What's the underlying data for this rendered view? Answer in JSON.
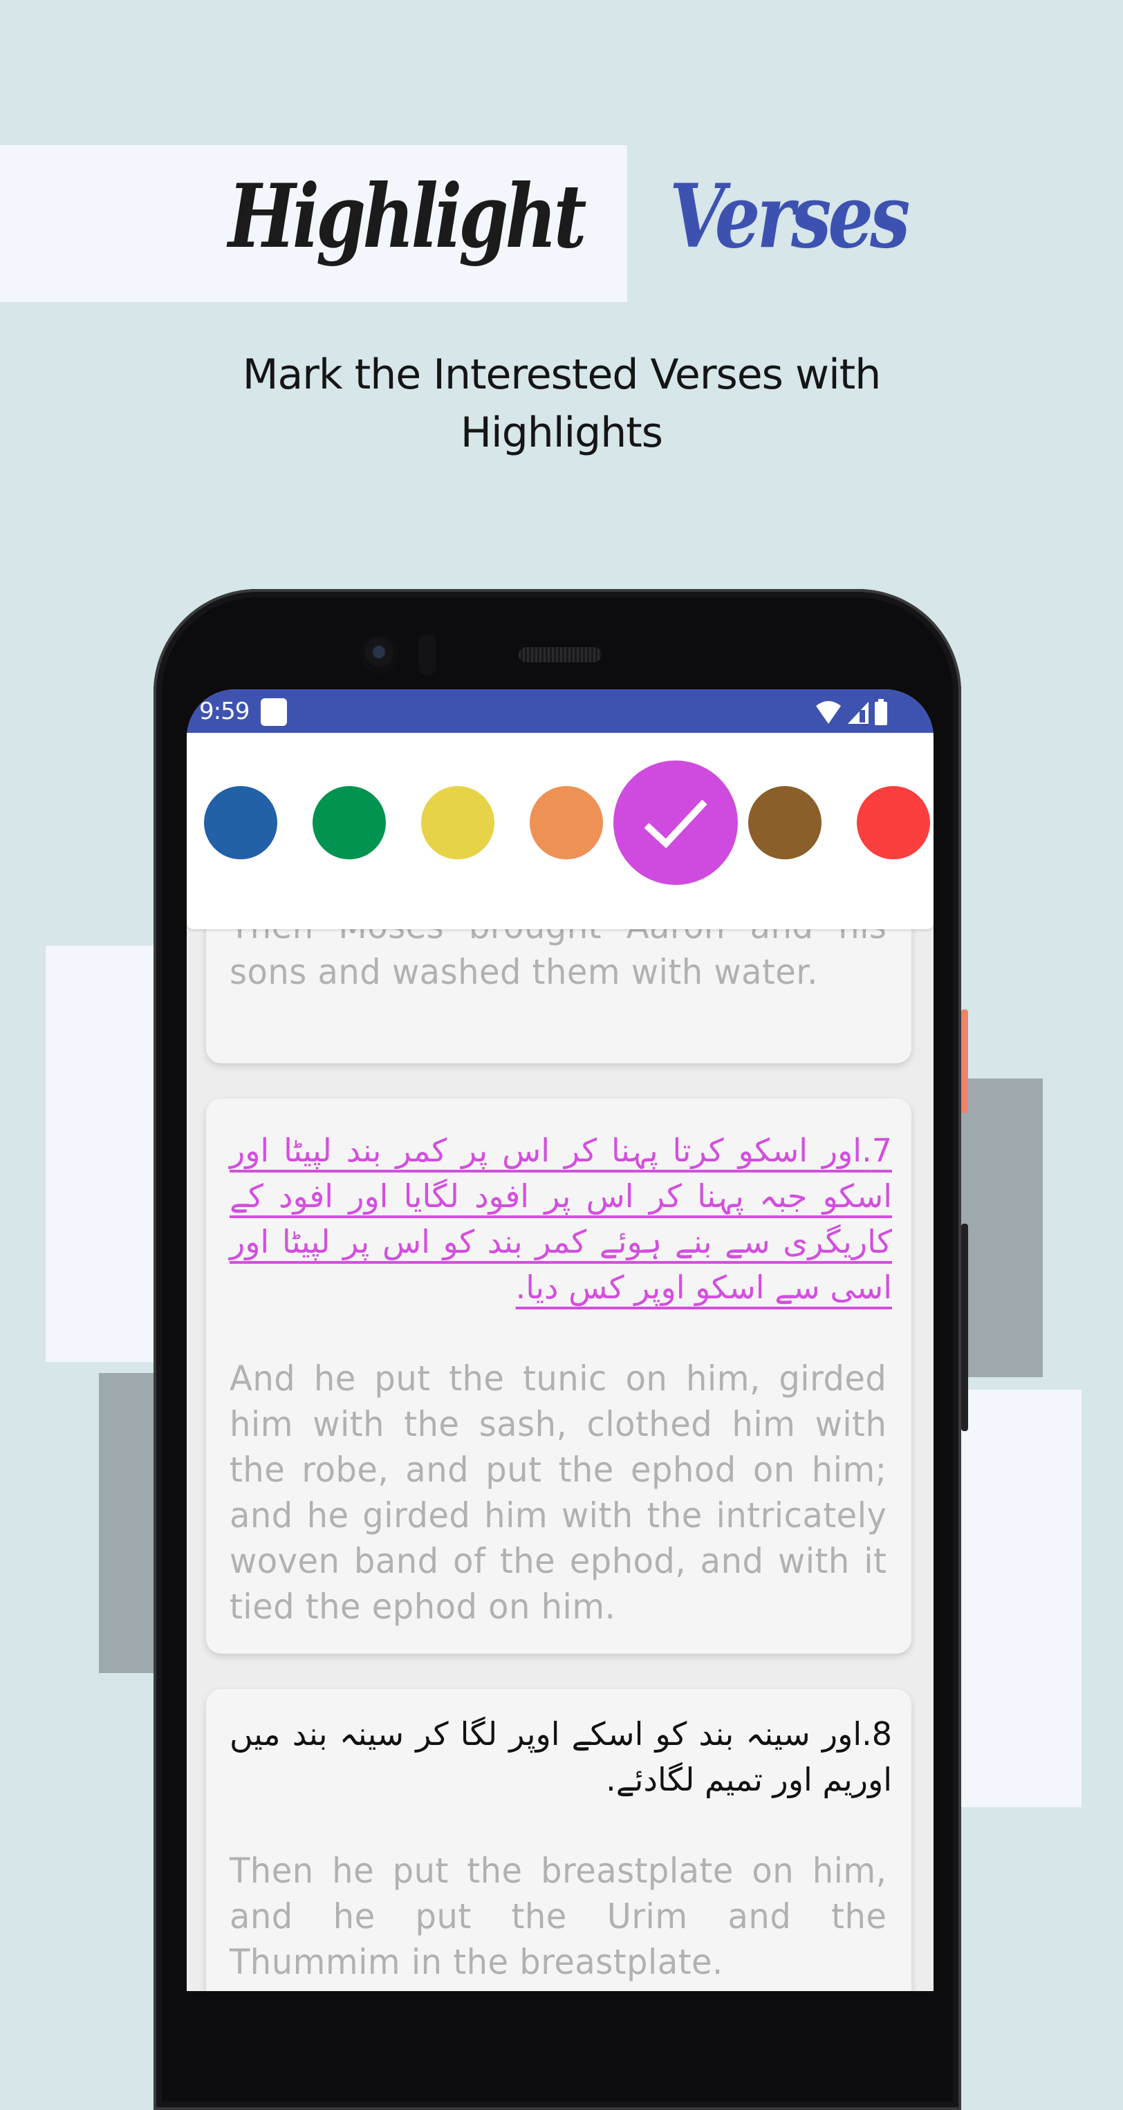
{
  "header": {
    "title_word_1": "Highlight",
    "title_word_2": "Verses",
    "title_color_1": "#1b1b1b",
    "title_color_2": "#3d52b0",
    "subtitle": "Mark the Interested Verses with Highlights"
  },
  "status_bar": {
    "time": "9:59",
    "icons": [
      "notification-icon",
      "wifi-icon",
      "signal-icon",
      "battery-icon"
    ],
    "color": "#3e53b0"
  },
  "palette": {
    "selected_index": 4,
    "swatches": [
      {
        "name": "blue",
        "color": "#2260a8"
      },
      {
        "name": "green",
        "color": "#019450"
      },
      {
        "name": "yellow",
        "color": "#e7d347"
      },
      {
        "name": "orange",
        "color": "#ee9154"
      },
      {
        "name": "magenta",
        "color": "#cf4adf"
      },
      {
        "name": "brown",
        "color": "#8b5f2a"
      },
      {
        "name": "red",
        "color": "#fb3e3e"
      }
    ]
  },
  "verses": [
    {
      "urdu": "",
      "english": "Then Moses brought Aaron and his sons and washed them with water.",
      "highlighted": false
    },
    {
      "urdu": "7.اور اسکو کرتا پہنا کر اس پر کمر بند لپیٹا اور اسکو جبہ پہنا کر اس پر افود لگایا اور افود کے کاریگری سے بنے ہوئے کمر بند کو اس پر لپیٹا اور اسی سے اسکو اوپر کس دیا.",
      "english": "And he put the tunic on him, girded him with the sash, clothed him with the robe, and put the ephod on him; and he girded him with the intricately woven band of the ephod, and with it tied the ephod on him.",
      "highlighted": true,
      "highlight_color": "#d34fde"
    },
    {
      "urdu": "8.اور سینہ بند کو اسکے اوپر لگا کر سینہ بند میں اوریم اور تمیم لگادئے.",
      "english": "Then he put the breastplate on him, and he put the Urim and the Thummim in the breastplate.",
      "highlighted": false
    }
  ]
}
